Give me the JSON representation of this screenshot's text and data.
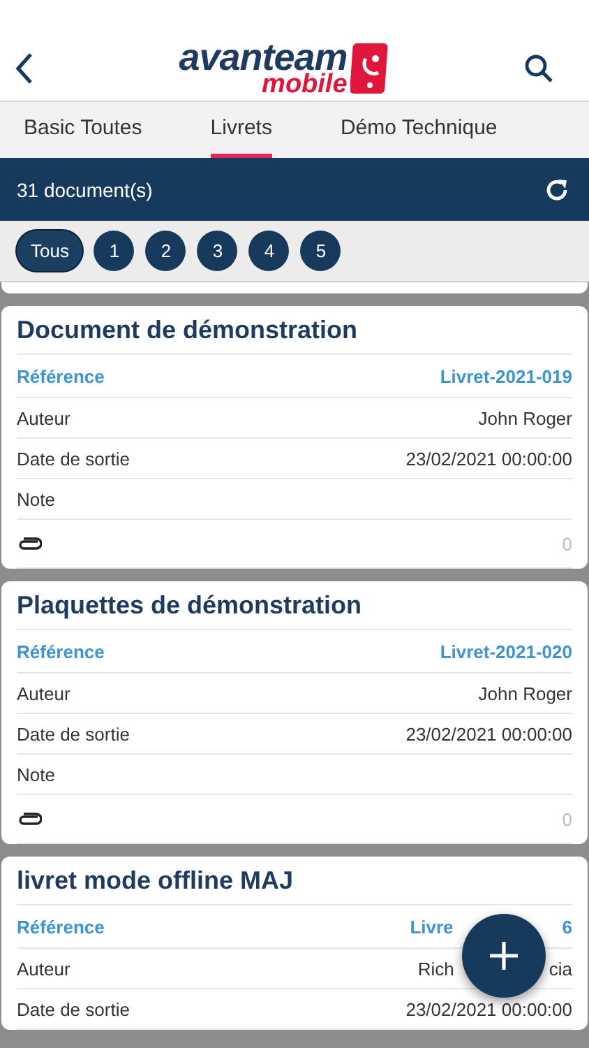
{
  "header": {
    "logo_main": "avanteam",
    "logo_sub": "mobile"
  },
  "tabs": [
    {
      "label": "Basic Toutes",
      "selected": false
    },
    {
      "label": "Livrets",
      "selected": true
    },
    {
      "label": "Démo Technique",
      "selected": false
    }
  ],
  "summary": {
    "count": "31 document(s)"
  },
  "filters": [
    {
      "label": "Tous",
      "selected": true
    },
    {
      "label": "1",
      "selected": false
    },
    {
      "label": "2",
      "selected": false
    },
    {
      "label": "3",
      "selected": false
    },
    {
      "label": "4",
      "selected": false
    },
    {
      "label": "5",
      "selected": false
    }
  ],
  "cards": [
    {
      "title": "Document de démonstration",
      "rows": [
        {
          "kind": "reference",
          "label": "Référence",
          "value_parts": [
            "Livret-2021-019"
          ]
        },
        {
          "kind": "field",
          "label": "Auteur",
          "value_parts": [
            "John Roger"
          ]
        },
        {
          "kind": "field",
          "label": "Date de sortie",
          "value_parts": [
            "23/02/2021 00:00:00"
          ]
        },
        {
          "kind": "field",
          "label": "Note",
          "value_parts": []
        },
        {
          "kind": "attachments",
          "count": "0"
        }
      ]
    },
    {
      "title": "Plaquettes de démonstration",
      "rows": [
        {
          "kind": "reference",
          "label": "Référence",
          "value_parts": [
            "Livret-2021-020"
          ]
        },
        {
          "kind": "field",
          "label": "Auteur",
          "value_parts": [
            "John Roger"
          ]
        },
        {
          "kind": "field",
          "label": "Date de sortie",
          "value_parts": [
            "23/02/2021 00:00:00"
          ]
        },
        {
          "kind": "field",
          "label": "Note",
          "value_parts": []
        },
        {
          "kind": "attachments",
          "count": "0"
        }
      ]
    },
    {
      "title": "livret mode offline MAJ",
      "rows": [
        {
          "kind": "reference",
          "label": "Référence",
          "value_parts": [
            "Livre",
            "6"
          ]
        },
        {
          "kind": "field",
          "label": "Auteur",
          "value_parts": [
            "Rich",
            "cia"
          ]
        },
        {
          "kind": "field",
          "label": "Date de sortie",
          "value_parts": [
            "23/02/2021 00:00:00"
          ]
        }
      ]
    }
  ]
}
